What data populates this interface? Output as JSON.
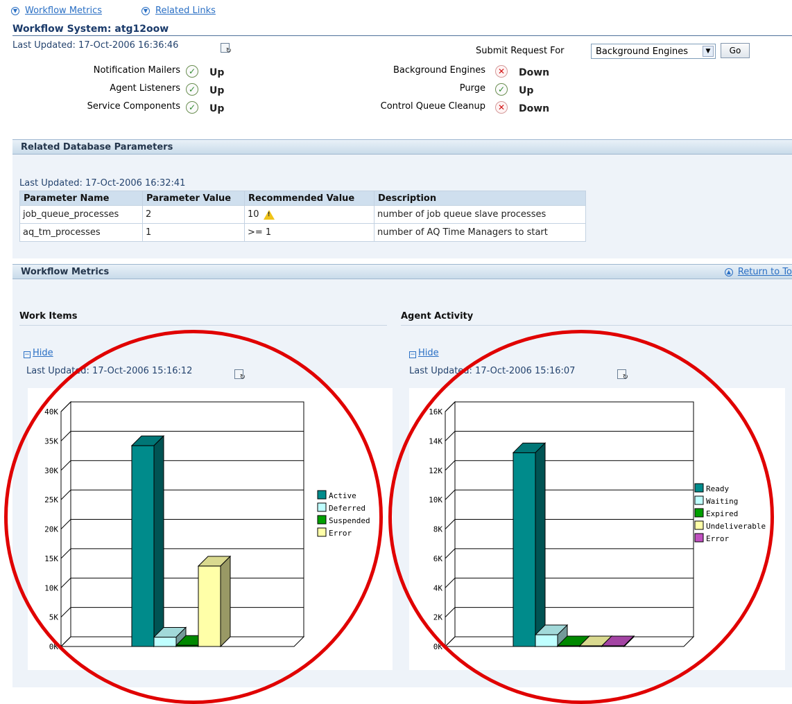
{
  "nav": {
    "workflow_metrics": "Workflow Metrics",
    "related_links": "Related Links"
  },
  "system": {
    "title": "Workflow System: atg12oow",
    "last_updated": "Last Updated: 17-Oct-2006 16:36:46",
    "submit_label": "Submit Request For",
    "submit_select": "Background Engines",
    "go_label": "Go",
    "status_left": [
      {
        "label": "Notification Mailers",
        "value": "Up",
        "ok": true
      },
      {
        "label": "Agent Listeners",
        "value": "Up",
        "ok": true
      },
      {
        "label": "Service Components",
        "value": "Up",
        "ok": true
      }
    ],
    "status_right": [
      {
        "label": "Background Engines",
        "value": "Down",
        "ok": false
      },
      {
        "label": "Purge",
        "value": "Up",
        "ok": true
      },
      {
        "label": "Control Queue Cleanup",
        "value": "Down",
        "ok": false
      }
    ]
  },
  "db_params": {
    "section_title": "Related Database Parameters",
    "last_updated": "Last Updated: 17-Oct-2006 16:32:41",
    "headers": [
      "Parameter Name",
      "Parameter Value",
      "Recommended Value",
      "Description"
    ],
    "rows": [
      [
        "job_queue_processes",
        "2",
        "10",
        "number of job queue slave processes"
      ],
      [
        "aq_tm_processes",
        "1",
        ">= 1",
        "number of AQ Time Managers to start"
      ]
    ]
  },
  "metrics": {
    "section_title": "Workflow Metrics",
    "return_label": "Return to To",
    "hide_label": "Hide"
  },
  "chart_data": [
    {
      "type": "bar",
      "title": "Work Items",
      "last_updated": "Last Updated: 17-Oct-2006 15:16:12",
      "categories": [
        "Active",
        "Deferred",
        "Suspended",
        "Error"
      ],
      "values": [
        34200,
        1600,
        200,
        13700
      ],
      "colors": [
        "#008b8b",
        "#bfffff",
        "#00a000",
        "#ffffa8"
      ],
      "ylim": [
        0,
        40000
      ],
      "yticks": [
        "0K",
        "5K",
        "10K",
        "15K",
        "20K",
        "25K",
        "30K",
        "35K",
        "40K"
      ],
      "legend": "right",
      "grid": true
    },
    {
      "type": "bar",
      "title": "Agent Activity",
      "last_updated": "Last Updated: 17-Oct-2006 15:16:07",
      "categories": [
        "Ready",
        "Waiting",
        "Expired",
        "Undeliverable",
        "Error"
      ],
      "values": [
        13200,
        800,
        50,
        50,
        50
      ],
      "colors": [
        "#008b8b",
        "#bfffff",
        "#00a000",
        "#ffffa8",
        "#c050c0"
      ],
      "ylim": [
        0,
        16000
      ],
      "yticks": [
        "0K",
        "2K",
        "4K",
        "6K",
        "8K",
        "10K",
        "12K",
        "14K",
        "16K"
      ],
      "legend": "right",
      "grid": true
    }
  ]
}
